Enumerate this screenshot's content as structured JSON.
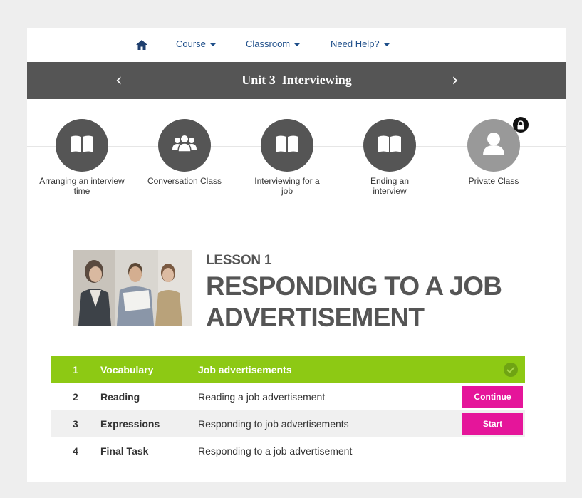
{
  "nav": {
    "home_icon": "home-icon",
    "items": [
      {
        "label": "Course"
      },
      {
        "label": "Classroom"
      },
      {
        "label": "Need Help?"
      }
    ]
  },
  "unit": {
    "title": "Unit 3  Interviewing",
    "prev_icon": "chevron-left-icon",
    "next_icon": "chevron-right-icon"
  },
  "activities": [
    {
      "label": "Arranging an interview time",
      "icon": "book-icon",
      "locked": false
    },
    {
      "label": "Conversation Class",
      "icon": "group-icon",
      "locked": false
    },
    {
      "label": "Interviewing for a job",
      "icon": "book-icon",
      "locked": false
    },
    {
      "label": "Ending an interview",
      "icon": "book-icon",
      "locked": false
    },
    {
      "label": "Private Class",
      "icon": "user-icon",
      "locked": true
    }
  ],
  "lesson": {
    "kicker": "LESSON 1",
    "title": "RESPONDING TO A JOB ADVERTISEMENT"
  },
  "steps": [
    {
      "num": "1",
      "type": "Vocabulary",
      "desc": "Job advertisements",
      "state": "completed",
      "button": ""
    },
    {
      "num": "2",
      "type": "Reading",
      "desc": "Reading a job advertisement",
      "state": "in-progress",
      "button": "Continue"
    },
    {
      "num": "3",
      "type": "Expressions",
      "desc": "Responding to job advertisements",
      "state": "available",
      "button": "Start"
    },
    {
      "num": "4",
      "type": "Final Task",
      "desc": "Responding to a job advertisement",
      "state": "not-started",
      "button": ""
    }
  ],
  "colors": {
    "accent_green": "#8dc914",
    "button_pink": "#e5159a",
    "unit_bar": "#555555",
    "nav_link": "#1f4f8a"
  }
}
